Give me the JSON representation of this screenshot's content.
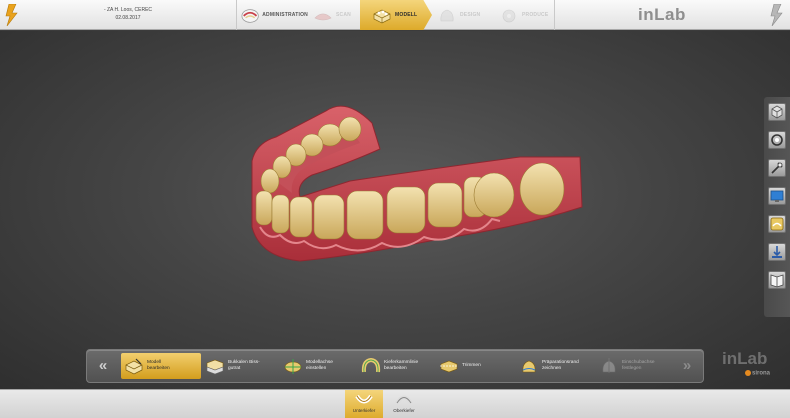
{
  "header": {
    "case_name": "- ZA H. Loos, CEREC",
    "case_date": "02.08.2017",
    "phases": [
      {
        "label": "ADMINISTRATION",
        "state": "normal",
        "icon": "administration-icon"
      },
      {
        "label": "SCAN",
        "state": "inactive",
        "icon": "scan-icon"
      },
      {
        "label": "MODELL",
        "state": "active",
        "icon": "model-icon"
      },
      {
        "label": "DESIGN",
        "state": "inactive",
        "icon": "design-icon"
      },
      {
        "label": "PRODUCE",
        "state": "inactive",
        "icon": "produce-icon"
      }
    ],
    "brand": "inLab"
  },
  "side_tools": [
    {
      "icon": "view-cube-icon"
    },
    {
      "icon": "rotate-view-icon"
    },
    {
      "icon": "tool-icon"
    },
    {
      "icon": "screen-icon"
    },
    {
      "icon": "model-settings-icon"
    },
    {
      "icon": "export-icon"
    },
    {
      "icon": "book-icon"
    }
  ],
  "steps": {
    "prev_label": "«",
    "next_label": "»",
    "items": [
      {
        "label": "Modell bearbeiten",
        "state": "active",
        "icon": "edit-model-icon"
      },
      {
        "label": "Bukkalen Biss-gutrat",
        "state": "normal",
        "icon": "buccal-bite-icon"
      },
      {
        "label": "Modellachse einstellen",
        "state": "normal",
        "icon": "model-axis-icon"
      },
      {
        "label": "Kieferkammlinie bearbeiten",
        "state": "normal",
        "icon": "jaw-ridge-icon"
      },
      {
        "label": "Trimmen",
        "state": "normal",
        "icon": "trim-icon"
      },
      {
        "label": "Präparationsrand zeichnen",
        "state": "normal",
        "icon": "margin-line-icon"
      },
      {
        "label": "Einschubachse festlegen",
        "state": "disabled",
        "icon": "insertion-axis-icon"
      }
    ]
  },
  "brand_bottom": {
    "name": "inLab",
    "maker": "sirona"
  },
  "jaws": [
    {
      "label": "Unterkiefer",
      "state": "active",
      "icon": "lower-jaw-icon"
    },
    {
      "label": "Oberkiefer",
      "state": "normal",
      "icon": "upper-jaw-icon"
    }
  ],
  "colors": {
    "accent": "#ddaa2a",
    "gum": "#c9414a",
    "tooth": "#e6cf93"
  }
}
